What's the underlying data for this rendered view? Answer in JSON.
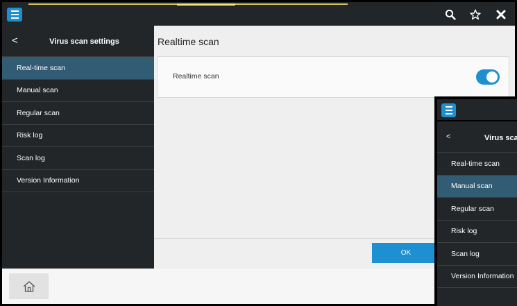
{
  "topbar": {
    "icons": [
      "menu-icon",
      "search-icon",
      "star-icon",
      "close-icon"
    ]
  },
  "sidebar": {
    "back_glyph": "<",
    "title": "Virus scan settings",
    "items": [
      {
        "label": "Real-time scan",
        "active": true
      },
      {
        "label": "Manual scan",
        "active": false
      },
      {
        "label": "Regular scan",
        "active": false
      },
      {
        "label": "Risk log",
        "active": false
      },
      {
        "label": "Scan log",
        "active": false
      },
      {
        "label": "Version Information",
        "active": false
      }
    ]
  },
  "main": {
    "title": "Realtime scan",
    "setting": {
      "label": "Realtime scan",
      "enabled": true
    },
    "ok_label": "OK"
  },
  "bottom": {
    "home_icon": "home-icon"
  },
  "overlay": {
    "back_glyph": "<",
    "title": "Virus scar",
    "items": [
      {
        "label": "Real-time scan",
        "active": false
      },
      {
        "label": "Manual scan",
        "active": true
      },
      {
        "label": "Regular scan",
        "active": false
      },
      {
        "label": "Risk log",
        "active": false
      },
      {
        "label": "Scan log",
        "active": false
      },
      {
        "label": "Version Information",
        "active": false
      }
    ]
  },
  "colors": {
    "accent": "#1e8fd0",
    "active_item": "#325b74",
    "panel_dark": "#222628",
    "main_bg": "#efefef"
  }
}
